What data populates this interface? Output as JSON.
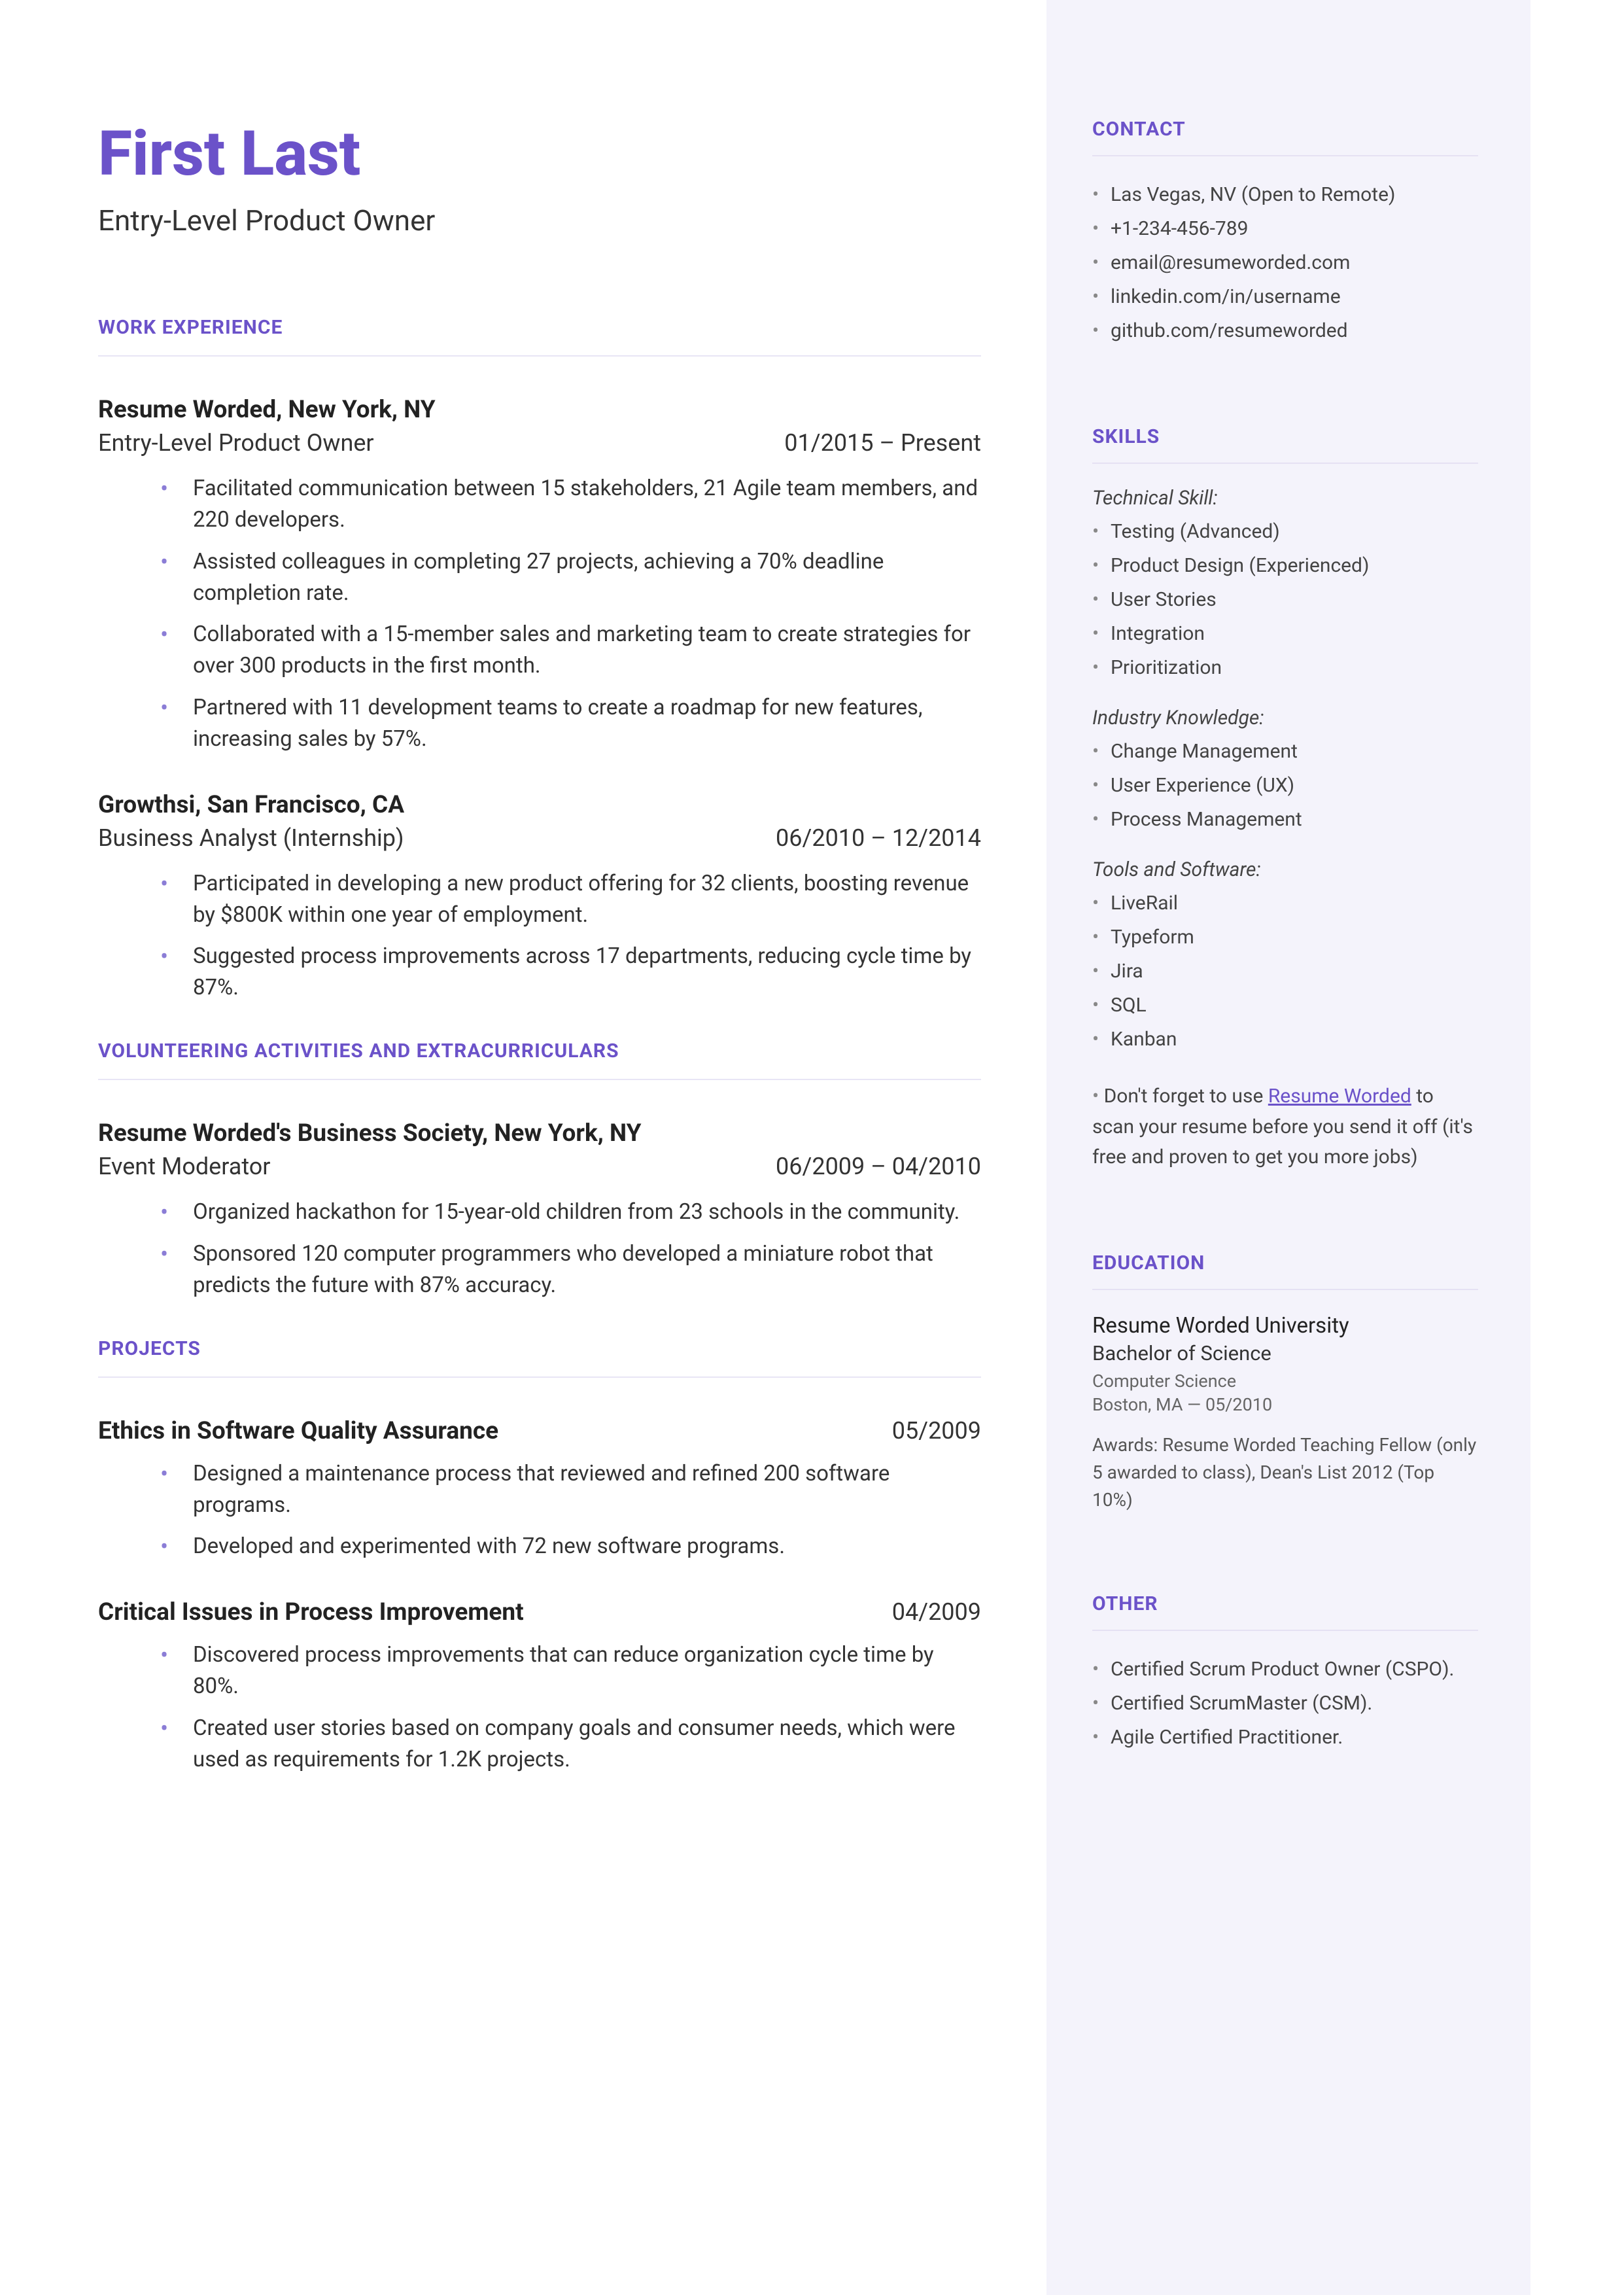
{
  "header": {
    "name": "First Last",
    "title": "Entry-Level Product Owner"
  },
  "sections": {
    "work_experience": "WORK EXPERIENCE",
    "volunteering": "VOLUNTEERING ACTIVITIES AND EXTRACURRICULARS",
    "projects": "PROJECTS",
    "contact": "CONTACT",
    "skills": "SKILLS",
    "education": "EDUCATION",
    "other": "OTHER"
  },
  "jobs": [
    {
      "company": "Resume Worded, New York, NY",
      "role": "Entry-Level Product Owner",
      "dates": "01/2015 – Present",
      "bullets": [
        "Facilitated communication between 15 stakeholders, 21 Agile team members, and 220 developers.",
        "Assisted colleagues in completing 27 projects, achieving a 70% deadline completion rate.",
        "Collaborated with a 15-member sales and marketing team to create strategies for over 300 products in the first month.",
        "Partnered with 11 development teams to create a roadmap for new features, increasing sales by 57%."
      ]
    },
    {
      "company": "Growthsi, San Francisco, CA",
      "role": "Business Analyst (Internship)",
      "dates": "06/2010 – 12/2014",
      "bullets": [
        "Participated in developing a new product offering for 32 clients, boosting revenue by $800K within one year of employment.",
        "Suggested process improvements across 17 departments, reducing cycle time by 87%."
      ]
    }
  ],
  "volunteering": [
    {
      "company": "Resume Worded's Business Society, New York, NY",
      "role": "Event Moderator",
      "dates": "06/2009 – 04/2010",
      "bullets": [
        "Organized hackathon for 15-year-old children from 23 schools in the community.",
        "Sponsored 120 computer programmers who developed a miniature robot that predicts the future with 87% accuracy."
      ]
    }
  ],
  "projects_list": [
    {
      "title": "Ethics in Software Quality Assurance",
      "dates": "05/2009",
      "bullets": [
        "Designed a maintenance process that reviewed and refined 200 software programs.",
        "Developed and experimented with 72 new software programs."
      ]
    },
    {
      "title": "Critical Issues in Process Improvement",
      "dates": "04/2009",
      "bullets": [
        "Discovered process improvements that can reduce organization cycle time by 80%.",
        "Created user stories based on company goals and consumer needs, which were used as requirements for 1.2K projects."
      ]
    }
  ],
  "contact": [
    "Las Vegas, NV (Open to Remote)",
    "+1-234-456-789",
    "email@resumeworded.com",
    "linkedin.com/in/username",
    "github.com/resumeworded"
  ],
  "skills": {
    "technical_label": "Technical Skill:",
    "technical": [
      "Testing (Advanced)",
      "Product Design (Experienced)",
      "User Stories",
      "Integration",
      "Prioritization"
    ],
    "industry_label": "Industry Knowledge:",
    "industry": [
      "Change Management",
      "User Experience (UX)",
      "Process Management"
    ],
    "tools_label": "Tools and Software:",
    "tools": [
      "LiveRail",
      "Typeform",
      "Jira",
      "SQL",
      "Kanban"
    ]
  },
  "tip": {
    "prefix": "Don't forget to use ",
    "link": "Resume Worded",
    "suffix": " to scan your resume before you send it off (it's free and proven to get you more jobs)"
  },
  "education": {
    "school": "Resume Worded University",
    "degree": "Bachelor of Science",
    "field": "Computer Science",
    "location": "Boston, MA — 05/2010",
    "awards": "Awards: Resume Worded Teaching Fellow (only 5 awarded to class), Dean's List 2012 (Top 10%)"
  },
  "other": [
    "Certified Scrum Product Owner (CSPO).",
    "Certified ScrumMaster (CSM).",
    "Agile Certified Practitioner."
  ]
}
